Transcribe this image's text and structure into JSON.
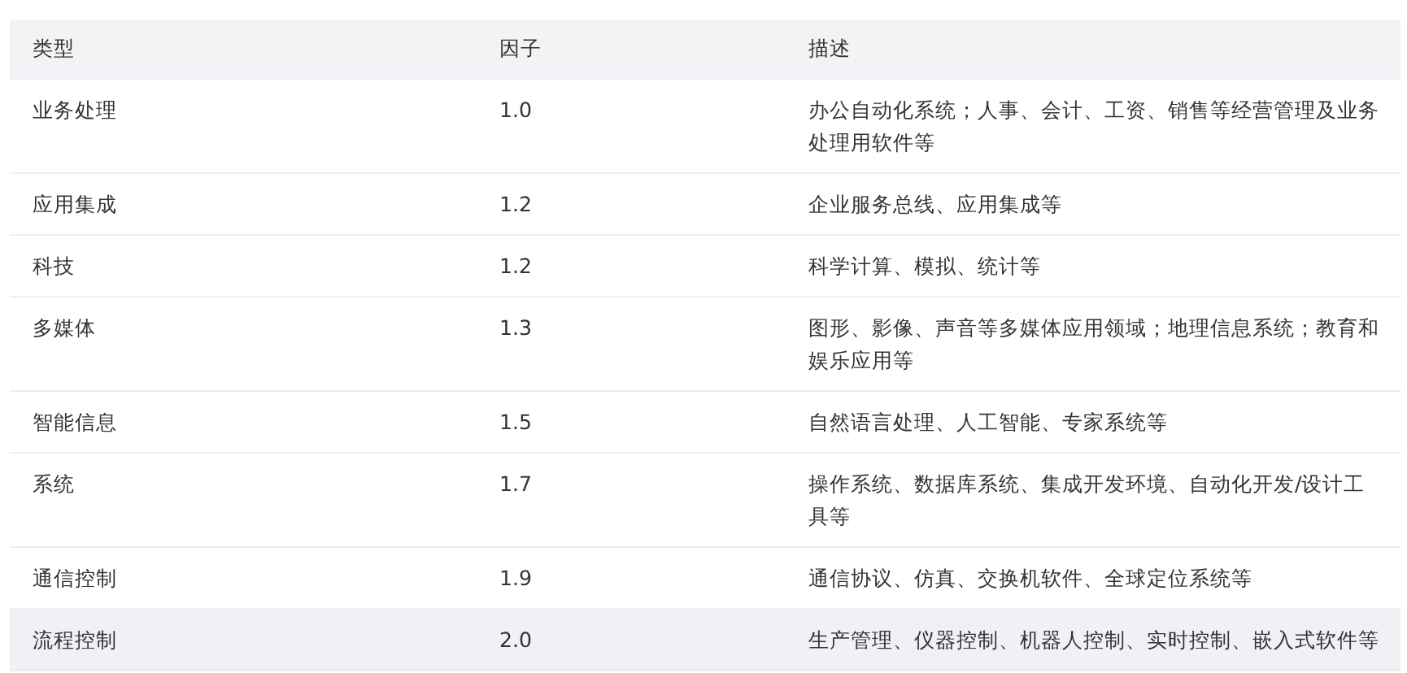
{
  "table": {
    "columns": [
      "类型",
      "因子",
      "描述"
    ],
    "rows": [
      {
        "cells": [
          "业务处理",
          "1.0",
          "办公自动化系统；人事、会计、工资、销售等经营管理及业务处理用软件等"
        ],
        "highlighted": false
      },
      {
        "cells": [
          "应用集成",
          "1.2",
          "企业服务总线、应用集成等"
        ],
        "highlighted": false
      },
      {
        "cells": [
          "科技",
          "1.2",
          "科学计算、模拟、统计等"
        ],
        "highlighted": false
      },
      {
        "cells": [
          "多媒体",
          "1.3",
          "图形、影像、声音等多媒体应用领域；地理信息系统；教育和娱乐应用等"
        ],
        "highlighted": false
      },
      {
        "cells": [
          "智能信息",
          "1.5",
          "自然语言处理、人工智能、专家系统等"
        ],
        "highlighted": false
      },
      {
        "cells": [
          "系统",
          "1.7",
          "操作系统、数据库系统、集成开发环境、自动化开发/设计工具等"
        ],
        "highlighted": false
      },
      {
        "cells": [
          "通信控制",
          "1.9",
          "通信协议、仿真、交换机软件、全球定位系统等"
        ],
        "highlighted": false
      },
      {
        "cells": [
          "流程控制",
          "2.0",
          "生产管理、仪器控制、机器人控制、实时控制、嵌入式软件等"
        ],
        "highlighted": true
      }
    ]
  }
}
